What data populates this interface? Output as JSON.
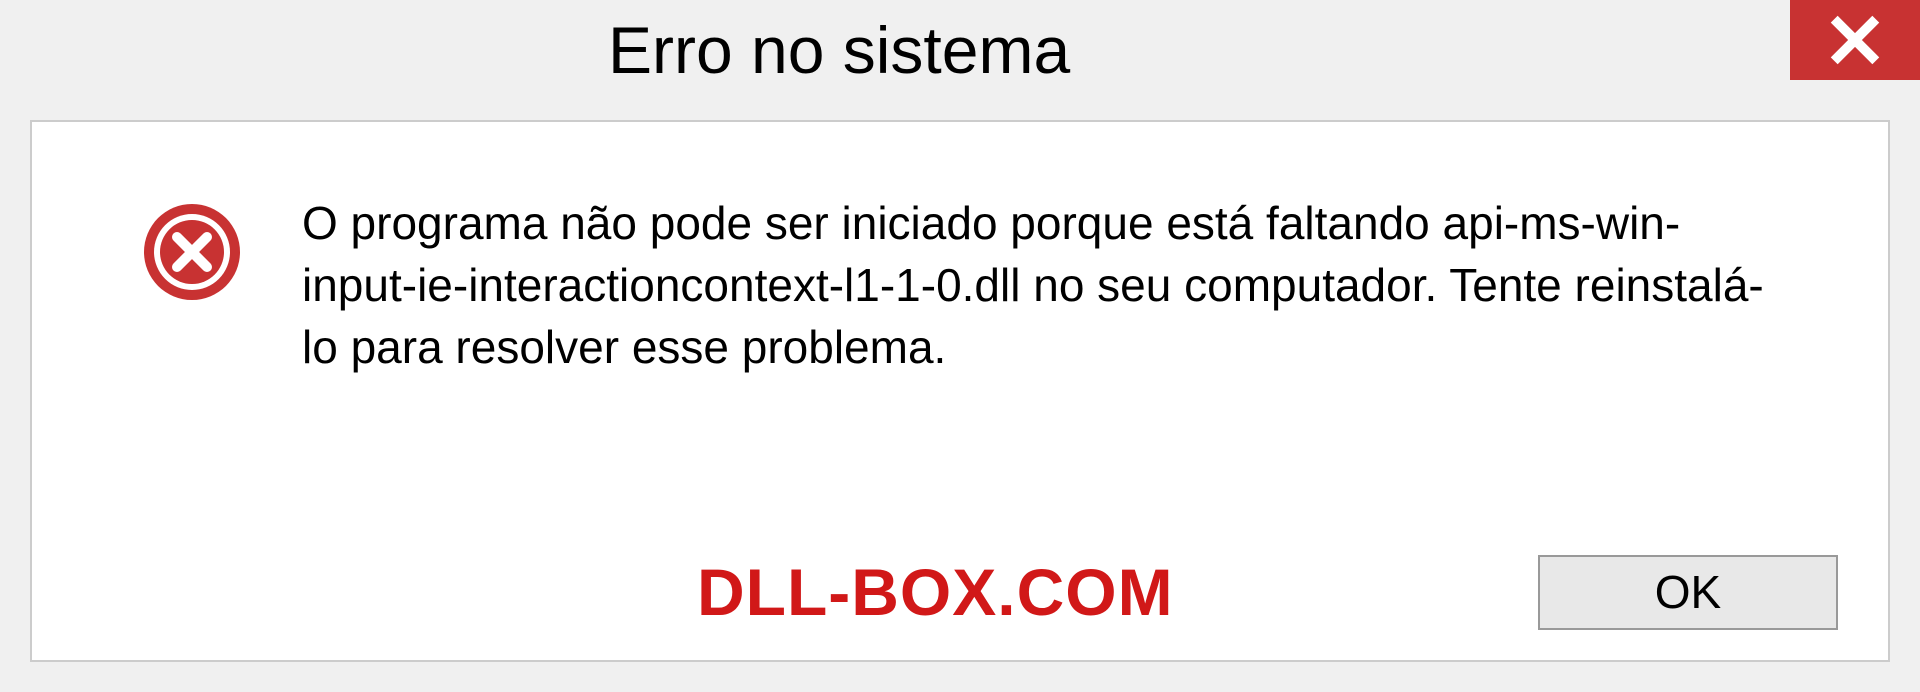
{
  "titlebar": {
    "title": "Erro no sistema"
  },
  "message": {
    "text": "O programa não pode ser iniciado porque está faltando api-ms-win-input-ie-interactioncontext-l1-1-0.dll no seu computador. Tente reinstalá-lo para resolver esse problema."
  },
  "footer": {
    "watermark": "DLL-BOX.COM",
    "ok_label": "OK"
  },
  "colors": {
    "close_bg": "#c83232",
    "watermark": "#d11818"
  }
}
